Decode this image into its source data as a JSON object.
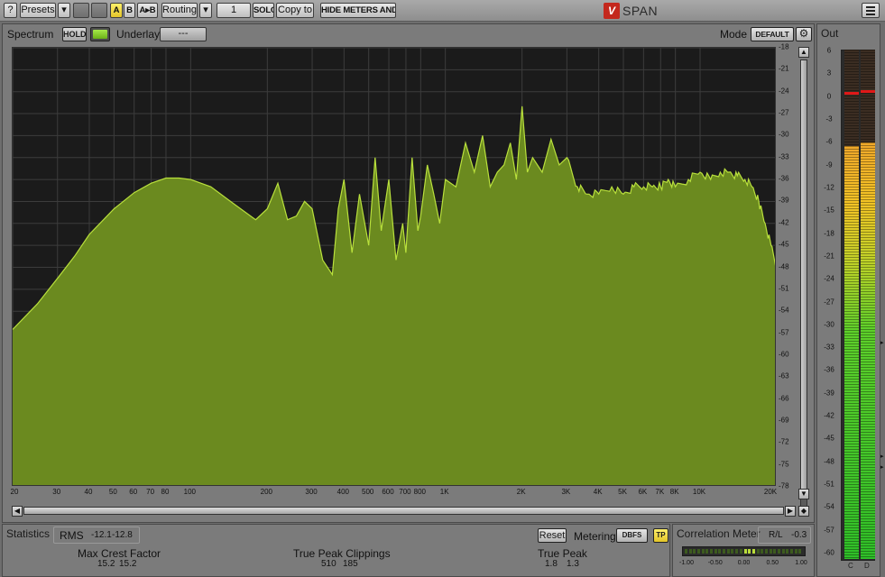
{
  "toolbar": {
    "help": "?",
    "presets": "Presets",
    "dropdown": "▾",
    "a": "A",
    "b": "B",
    "a_to_b": "A▸B",
    "routing": "Routing",
    "routing_value": "1",
    "solo": "SOLO",
    "copy_to": "Copy to",
    "hide_meters": "HIDE METERS AND STATS",
    "app_name": "SPAN"
  },
  "spectrum": {
    "title": "Spectrum",
    "hold": "HOLD",
    "underlay_label": "Underlay",
    "underlay_value": "---",
    "mode_label": "Mode",
    "mode_value": "DEFAULT",
    "fill_color": "#6b8a1f",
    "line_color": "#b9e03c"
  },
  "chart_data": {
    "type": "area",
    "xscale": "log",
    "xlim": [
      20,
      20000
    ],
    "ylim": [
      -78,
      -18
    ],
    "x_ticks": [
      "20",
      "30",
      "40",
      "50",
      "60",
      "70",
      "80",
      "100",
      "200",
      "300",
      "400",
      "500",
      "600",
      "700",
      "800",
      "1K",
      "2K",
      "3K",
      "4K",
      "5K",
      "6K",
      "7K",
      "8K",
      "10K",
      "20K"
    ],
    "x_tick_values": [
      20,
      30,
      40,
      50,
      60,
      70,
      80,
      100,
      200,
      300,
      400,
      500,
      600,
      700,
      800,
      1000,
      2000,
      3000,
      4000,
      5000,
      6000,
      7000,
      8000,
      10000,
      20000
    ],
    "y_ticks": [
      "-18",
      "-21",
      "-24",
      "-27",
      "-30",
      "-33",
      "-36",
      "-39",
      "-42",
      "-45",
      "-48",
      "-51",
      "-54",
      "-57",
      "-60",
      "-63",
      "-66",
      "-69",
      "-72",
      "-75",
      "-78"
    ],
    "y_tick_values": [
      -18,
      -21,
      -24,
      -27,
      -30,
      -33,
      -36,
      -39,
      -42,
      -45,
      -48,
      -51,
      -54,
      -57,
      -60,
      -63,
      -66,
      -69,
      -72,
      -75,
      -78
    ],
    "x": [
      20,
      25,
      30,
      35,
      40,
      50,
      60,
      70,
      80,
      90,
      100,
      120,
      150,
      180,
      200,
      220,
      240,
      260,
      280,
      300,
      330,
      360,
      380,
      400,
      430,
      460,
      500,
      530,
      560,
      600,
      640,
      680,
      700,
      740,
      780,
      800,
      850,
      900,
      950,
      1000,
      1100,
      1200,
      1300,
      1400,
      1500,
      1600,
      1700,
      1800,
      1900,
      2000,
      2100,
      2200,
      2400,
      2600,
      2800,
      3000,
      3300,
      3600,
      4000,
      4500,
      5000,
      5500,
      6000,
      6500,
      7000,
      7500,
      8000,
      9000,
      10000,
      11000,
      12000,
      13000,
      14000,
      15000,
      16000,
      17000,
      18000,
      19000,
      20000
    ],
    "y": [
      -56.5,
      -53,
      -49.5,
      -46.5,
      -43.5,
      -40,
      -37.8,
      -36.5,
      -35.8,
      -35.8,
      -36,
      -37,
      -39.5,
      -41.5,
      -40,
      -36.5,
      -41.5,
      -41,
      -39,
      -40,
      -47,
      -49,
      -40,
      -36,
      -46,
      -38,
      -45,
      -33,
      -43,
      -36,
      -47,
      -42,
      -46,
      -33,
      -43,
      -41,
      -34,
      -38,
      -42,
      -36,
      -37,
      -31,
      -35,
      -30,
      -37,
      -35,
      -34,
      -31,
      -36,
      -26,
      -35,
      -33,
      -35,
      -30.5,
      -34,
      -33,
      -37,
      -38,
      -38,
      -37,
      -38,
      -37,
      -37,
      -37,
      -37,
      -36,
      -37,
      -36,
      -35,
      -36,
      -35,
      -35,
      -35.5,
      -36,
      -37,
      -39,
      -42,
      -45,
      -48
    ]
  },
  "out_meter": {
    "title": "Out",
    "scale": [
      "6",
      "3",
      "0",
      "-3",
      "-6",
      "-9",
      "-12",
      "-15",
      "-18",
      "-21",
      "-24",
      "-27",
      "-30",
      "-33",
      "-36",
      "-39",
      "-42",
      "-45",
      "-48",
      "-51",
      "-54",
      "-57",
      "-60"
    ],
    "scale_values": [
      6,
      3,
      0,
      -3,
      -6,
      -9,
      -12,
      -15,
      -18,
      -21,
      -24,
      -27,
      -30,
      -33,
      -36,
      -39,
      -42,
      -45,
      -48,
      -51,
      -54,
      -57,
      -60
    ],
    "channels": [
      {
        "name": "C",
        "level_db": -6.5,
        "peak_db": 0.5
      },
      {
        "name": "D",
        "level_db": -6.0,
        "peak_db": 0.8
      }
    ]
  },
  "statistics": {
    "title": "Statistics",
    "rms_label": "RMS",
    "rms_l": "-12.1",
    "rms_r": "-12.8",
    "crest_label": "Max Crest Factor",
    "crest_l": "15.2",
    "crest_r": "15.2",
    "clip_label": "True Peak Clippings",
    "clip_l": "510",
    "clip_r": "185",
    "peak_label": "True Peak",
    "peak_l": "1.8",
    "peak_r": "1.3",
    "reset": "Reset",
    "metering_label": "Metering",
    "metering_value": "DBFS",
    "tp": "TP"
  },
  "correlation": {
    "title": "Correlation Meter",
    "rl_label": "R/L",
    "rl_value": "-0.3",
    "scale": [
      "-1.00",
      "-0.50",
      "0.00",
      "0.50",
      "1.00"
    ],
    "scale_values": [
      -1,
      -0.5,
      0,
      0.5,
      1
    ],
    "active_range": [
      0.0,
      0.2
    ]
  }
}
